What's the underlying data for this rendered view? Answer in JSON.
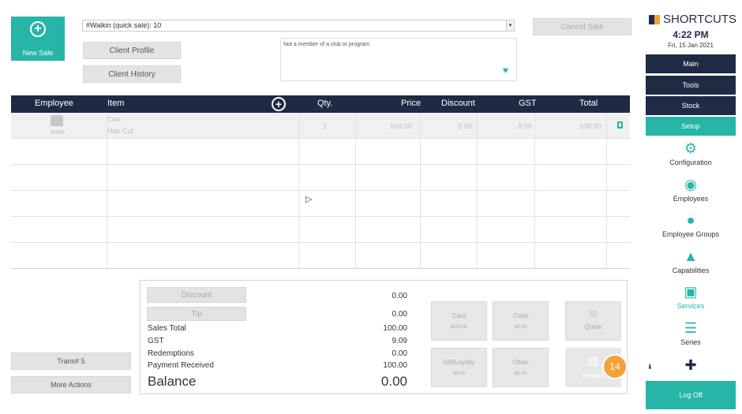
{
  "top": {
    "new_sale_label": "New Sale",
    "client_value": "#Walkin (quick sale): 10",
    "client_profile": "Client Profile",
    "client_history": "Client History",
    "membership_text": "Not a member of a club or program.",
    "cancel_sale": "Cancel Sale"
  },
  "table": {
    "headers": {
      "employee": "Employee",
      "item": "Item",
      "qty": "Qty.",
      "price": "Price",
      "discount": "Discount",
      "gst": "GST",
      "total": "Total"
    },
    "row": {
      "employee": "Imne",
      "item_category": "Cuts",
      "item_name": "Hair Cut",
      "qty": "1",
      "price": "100.00",
      "discount": "0.00",
      "gst": "9.09",
      "total": "100.00"
    }
  },
  "totals": {
    "discount_btn": "Discount",
    "tip_btn": "Tip",
    "discount_value": "0.00",
    "tip_value": "0.00",
    "sales_total_label": "Sales Total",
    "sales_total_value": "100.00",
    "gst_label": "GST",
    "gst_value": "9.09",
    "redemptions_label": "Redemptions",
    "redemptions_value": "0.00",
    "payment_label": "Payment Received",
    "payment_value": "100.00",
    "balance_label": "Balance",
    "balance_value": "0.00"
  },
  "payments": {
    "card": "Card",
    "card_amt": "$100.00",
    "cash": "Cash",
    "cash_amt": "$0.00",
    "gift": "Gift/Loyalty",
    "gift_amt": "$0.00",
    "other": "Other",
    "other_amt": "$0.00",
    "quote": "Quote",
    "receipt": "Receipt",
    "badge": "14"
  },
  "left_actions": {
    "trans": "Trans# 5",
    "more": "More Actions"
  },
  "sidebar": {
    "brand": "SHORTCUTS",
    "time": "4:22 PM",
    "date": "Fri, 15 Jan 2021",
    "nav": [
      "Main",
      "Tools",
      "Stock",
      "Setup"
    ],
    "items": [
      "Configuration",
      "Employees",
      "Employee Groups",
      "Capabilities",
      "Services",
      "Series"
    ],
    "logoff": "Log Off"
  },
  "colors": {
    "teal": "#26b5a6",
    "navy": "#1f2b44",
    "badge": "#f5a13a"
  }
}
